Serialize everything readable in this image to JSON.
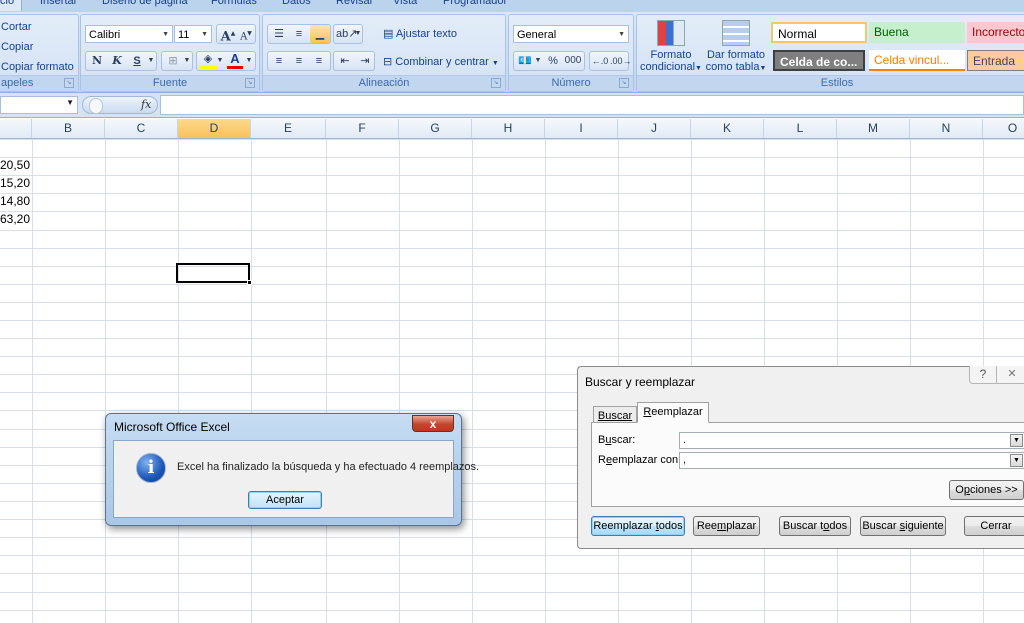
{
  "ribbon_tabs": [
    "cio",
    "Insertar",
    "Diseño de página",
    "Fórmulas",
    "Datos",
    "Revisar",
    "Vista",
    "Programador"
  ],
  "clipboard": {
    "cut": "Cortar",
    "copy": "Copiar",
    "format_painter": "Copiar formato",
    "label": "apeles"
  },
  "font": {
    "name": "Calibri",
    "size": "11",
    "bold": "N",
    "italic": "K",
    "underline": "S",
    "label": "Fuente"
  },
  "alignment": {
    "wrap_text": "Ajustar texto",
    "merge_center": "Combinar y centrar",
    "label": "Alineación"
  },
  "number": {
    "format": "General",
    "percent": "%",
    "thousands": "000",
    "label": "Número"
  },
  "styles": {
    "conditional_format": [
      "Formato",
      "condicional"
    ],
    "format_table": [
      "Dar formato",
      "como tabla"
    ],
    "cells": [
      {
        "label": "Normal",
        "bg": "#ffffff",
        "fg": "#000000"
      },
      {
        "label": "Buena",
        "bg": "#c6efce",
        "fg": "#006100"
      },
      {
        "label": "Incorrecto",
        "bg": "#ffc7ce",
        "fg": "#9c0006"
      },
      {
        "label": "Celda de co...",
        "bg": "#7f7f7f",
        "fg": "#ffffff"
      },
      {
        "label": "Celda vincul...",
        "bg": "#ffffff",
        "fg": "#fa7d00"
      },
      {
        "label": "Entrada",
        "bg": "#ffcc99",
        "fg": "#3f3f76"
      }
    ],
    "label": "Estilos"
  },
  "formula_bar": {
    "fx": "fx",
    "name_box": "",
    "content": ""
  },
  "columns": [
    "B",
    "C",
    "D",
    "E",
    "F",
    "G",
    "H",
    "I",
    "J",
    "K",
    "L",
    "M",
    "N",
    "O"
  ],
  "selected_column": "D",
  "column_a_values": [
    "",
    "20,50",
    "15,20",
    "14,80",
    "63,20"
  ],
  "message_box": {
    "title": "Microsoft Office Excel",
    "text": "Excel ha finalizado la búsqueda y ha efectuado 4 reemplazos.",
    "ok": "Aceptar",
    "close": "x"
  },
  "find_replace": {
    "title": "Buscar y reemplazar",
    "help": "?",
    "close": "✕",
    "tabs": [
      "Buscar",
      "Reemplazar"
    ],
    "active_tab": "Reemplazar",
    "find_label": "Buscar:",
    "find_value": ".",
    "replace_label": "Reemplazar con:",
    "replace_value": ",",
    "options": "Opciones >>",
    "buttons": [
      "Reemplazar todos",
      "Reemplazar",
      "Buscar todos",
      "Buscar siguiente",
      "Cerrar"
    ]
  }
}
